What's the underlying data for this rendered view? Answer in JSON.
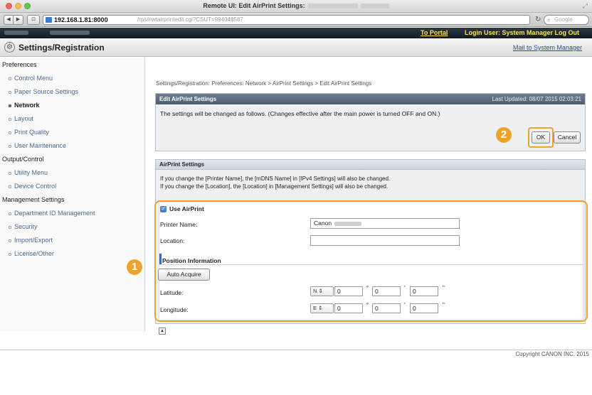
{
  "window": {
    "title": "Remote UI: Edit AirPrint Settings:"
  },
  "browser": {
    "url_host": "192.168.1.81:8000",
    "url_path": "/rps/nwtairprintedit.cgi?CSUT=994048587",
    "back_icon": "back-arrow-icon",
    "forward_icon": "forward-arrow-icon",
    "reload_icon": "reload-icon",
    "search_placeholder": "Google"
  },
  "header": {
    "portal_link": "To Portal",
    "login_text": "Login User: System Manager Log Out"
  },
  "subheader": {
    "title": "Settings/Registration",
    "mail_link": "Mail to System Manager"
  },
  "sidebar": {
    "groups": [
      {
        "heading": "Preferences",
        "items": [
          "Control Menu",
          "Paper Source Settings",
          "Network",
          "Layout",
          "Print Quality",
          "User Maintenance"
        ]
      },
      {
        "heading": "Output/Control",
        "items": [
          "Utility Menu",
          "Device Control"
        ]
      },
      {
        "heading": "Management Settings",
        "items": [
          "Department ID Management",
          "Security",
          "Import/Export",
          "License/Other"
        ]
      }
    ],
    "active_item": "Network"
  },
  "main": {
    "breadcrumb": "Settings/Registration: Preferences: Network > AirPrint Settings > Edit AirPrint Settings",
    "edit_panel": {
      "title": "Edit AirPrint Settings",
      "last_updated": "Last Updated: 08/07 2015 02:03:21",
      "notice": "The settings will be changed as follows. (Changes effective after the main power is turned OFF and ON.)",
      "ok_label": "OK",
      "cancel_label": "Cancel"
    },
    "airprint_panel": {
      "title": "AirPrint Settings",
      "info_line1": "If you change the [Printer Name], the [mDNS Name] in [IPv4 Settings] will also be changed.",
      "info_line2": "If you change the [Location], the [Location] in [Management Settings] will also be changed.",
      "use_airprint_label": "Use AirPrint",
      "use_airprint_checked": true,
      "printer_name_label": "Printer Name:",
      "printer_name_value": "Canon",
      "location_label": "Location:",
      "location_value": "",
      "position_heading": "Position Information",
      "auto_acquire_label": "Auto Acquire",
      "latitude_label": "Latitude:",
      "latitude_dir": "N",
      "latitude_deg": "0",
      "latitude_min": "0",
      "latitude_sec": "0",
      "longitude_label": "Longitude:",
      "longitude_dir": "E",
      "longitude_deg": "0",
      "longitude_min": "0",
      "longitude_sec": "0",
      "deg_symbol": "°",
      "min_symbol": "'",
      "sec_symbol": "\""
    },
    "callouts": [
      "1",
      "2"
    ],
    "accent_color": "#f0a22e"
  },
  "footer": {
    "copyright": "Copyright CANON INC. 2015"
  }
}
